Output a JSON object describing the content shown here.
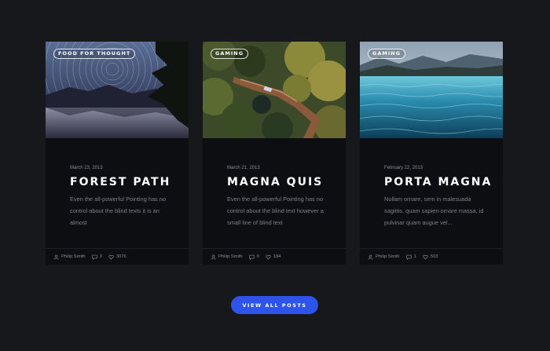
{
  "posts": [
    {
      "tag": "FOOD FOR THOUGHT",
      "date": "March 23, 2013",
      "title": "FOREST PATH",
      "excerpt": "Even the all-powerful Pointing has no control about the blind texts it is an almost",
      "author": "Philip Smith",
      "comments": "3",
      "likes": "3076"
    },
    {
      "tag": "GAMING",
      "date": "March 21, 2013",
      "title": "MAGNA QUIS",
      "excerpt": "Even the all-powerful Pointing has no control about the blind text however a small line of blind text",
      "author": "Philip Smith",
      "comments": "0",
      "likes": "184"
    },
    {
      "tag": "GAMING",
      "date": "February 22, 2013",
      "title": "PORTA MAGNA",
      "excerpt": "Nullam ornare, sem in malesuada sagittis, quam sapien ornare massa, id pulvinar quam augue vel...",
      "author": "Philip Smith",
      "comments": "1",
      "likes": "503"
    }
  ],
  "view_all_label": "VIEW ALL POSTS",
  "colors": {
    "accent": "#2f54eb",
    "background": "#17181c",
    "card": "#0d0e11"
  }
}
